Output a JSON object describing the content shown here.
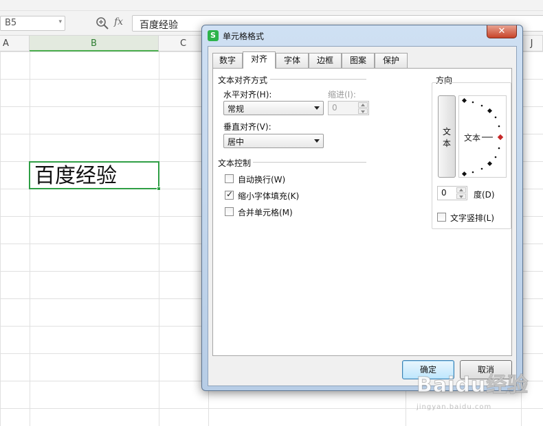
{
  "spreadsheet": {
    "name_box": "B5",
    "fx_label": "fx",
    "formula_value": "百度经验",
    "columns": [
      "A",
      "B",
      "C",
      "J"
    ],
    "active_cell_value": "百度经验"
  },
  "dialog": {
    "title": "单元格格式",
    "app_icon_letter": "S",
    "close_symbol": "✕",
    "tabs": [
      "数字",
      "对齐",
      "字体",
      "边框",
      "图案",
      "保护"
    ],
    "active_tab": "对齐",
    "text_alignment": {
      "group_label": "文本对齐方式",
      "horizontal_label": "水平对齐(H):",
      "horizontal_value": "常规",
      "indent_label": "缩进(I):",
      "indent_value": "0",
      "vertical_label": "垂直对齐(V):",
      "vertical_value": "居中"
    },
    "text_control": {
      "group_label": "文本控制",
      "wrap_text": {
        "label": "自动换行(W)",
        "checked": false
      },
      "shrink_to_fit": {
        "label": "缩小字体填充(K)",
        "checked": true
      },
      "merge_cells": {
        "label": "合并单元格(M)",
        "checked": false
      }
    },
    "orientation": {
      "group_label": "方向",
      "vertical_text": "文本",
      "dial_label": "文本",
      "degrees_value": "0",
      "degrees_label": "度(D)",
      "stacked_text": {
        "label": "文字竖排(L)",
        "checked": false
      }
    },
    "buttons": {
      "ok": "确定",
      "cancel": "取消"
    }
  },
  "watermark": {
    "text": "Baidu经验",
    "sub": "jingyan.baidu.com"
  },
  "colors": {
    "accent_green": "#2e9e44",
    "dialog_frame": "#b7cde6",
    "dial_marker": "#c62828"
  }
}
